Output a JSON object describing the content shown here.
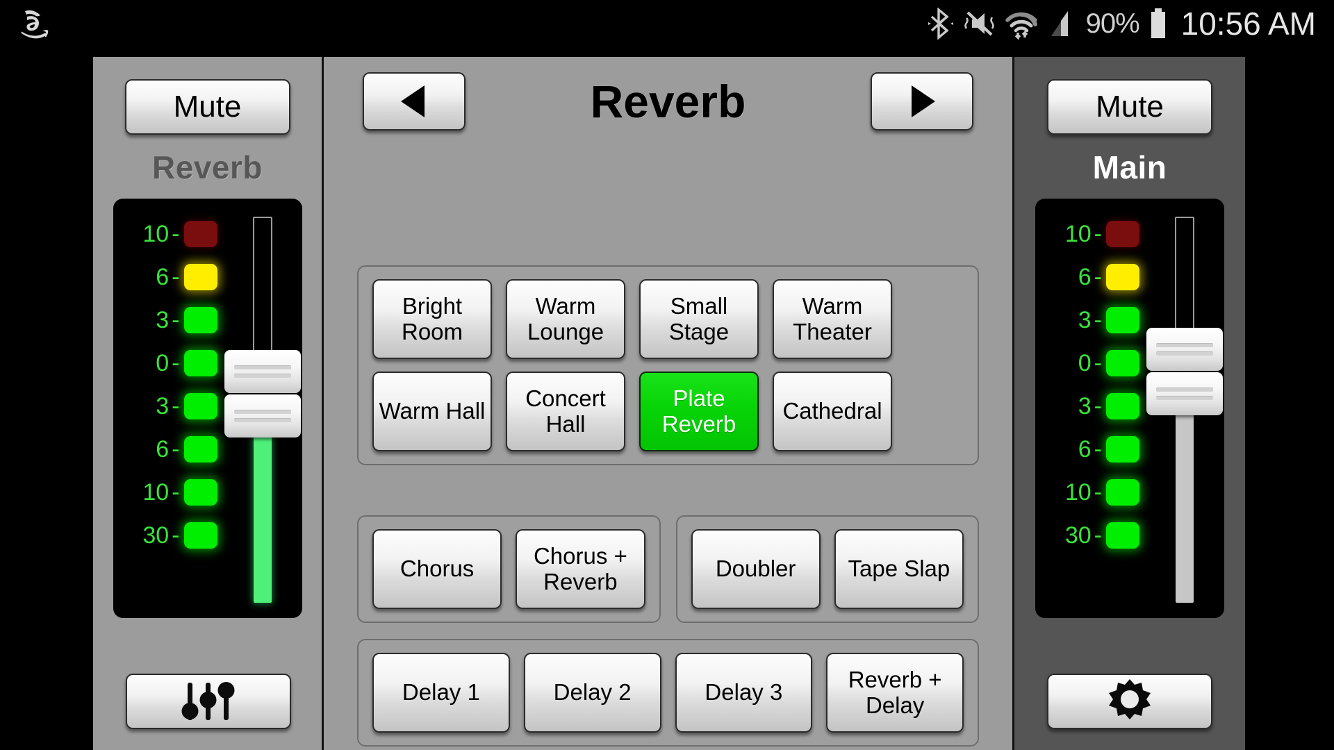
{
  "status_bar": {
    "app_icon": "amazon-a-icon",
    "icons": [
      "bluetooth-icon",
      "vibrate-muted-icon",
      "wifi-icon",
      "cellular-signal-icon"
    ],
    "battery_percent": "90%",
    "battery_icon": "battery-icon",
    "clock": "10:56 AM"
  },
  "left_channel": {
    "mute_label": "Mute",
    "name": "Reverb",
    "meter_scale": [
      "10",
      "6",
      "3",
      "0",
      "3",
      "6",
      "10",
      "30"
    ],
    "led_colors": [
      "r",
      "y",
      "g",
      "g",
      "g",
      "g",
      "g",
      "g"
    ],
    "fader_track_color": "#4ef07a",
    "bottom_button_icon": "eq-sliders-icon"
  },
  "center": {
    "prev_icon": "arrow-left-icon",
    "next_icon": "arrow-right-icon",
    "title": "Reverb",
    "groups": [
      {
        "name": "reverb-presets",
        "rows": [
          [
            "Bright Room",
            "Warm Lounge",
            "Small Stage",
            "Warm Theater"
          ],
          [
            "Warm Hall",
            "Concert Hall",
            "Plate Reverb",
            "Cathedral"
          ]
        ],
        "active": "Plate Reverb"
      },
      {
        "name": "modulation-presets",
        "buttons": [
          "Chorus",
          "Chorus + Reverb"
        ]
      },
      {
        "name": "doubler-presets",
        "buttons": [
          "Doubler",
          "Tape Slap"
        ]
      },
      {
        "name": "delay-presets",
        "buttons": [
          "Delay 1",
          "Delay 2",
          "Delay 3",
          "Reverb + Delay"
        ]
      }
    ]
  },
  "right_channel": {
    "mute_label": "Mute",
    "name": "Main",
    "meter_scale": [
      "10",
      "6",
      "3",
      "0",
      "3",
      "6",
      "10",
      "30"
    ],
    "led_colors": [
      "r",
      "y",
      "g",
      "g",
      "g",
      "g",
      "g",
      "g"
    ],
    "fader_track_color": "#c6c6c6",
    "bottom_button_icon": "gear-icon"
  },
  "colors": {
    "active_green": "#07d407",
    "panel_gray": "#9c9c9c",
    "right_panel_gray": "#555555",
    "led_green": "#00ee00",
    "led_yellow": "#ffee00",
    "led_red": "#7a0d0d",
    "label_green": "#39e23b"
  }
}
